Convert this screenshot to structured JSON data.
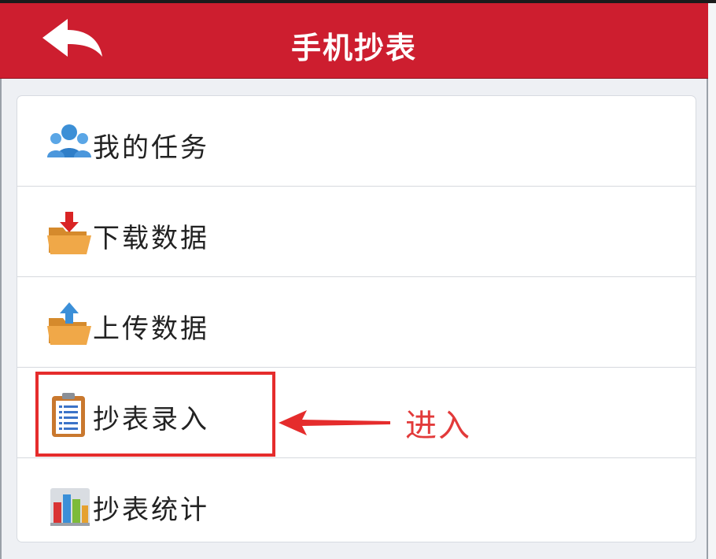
{
  "header": {
    "title": "手机抄表",
    "back_icon": "back-arrow-icon",
    "colors": {
      "bar": "#cd1e2f",
      "text": "#ffffff"
    }
  },
  "menu": {
    "items": [
      {
        "label": "我的任务",
        "icon": "users-icon"
      },
      {
        "label": "下载数据",
        "icon": "folder-download-icon"
      },
      {
        "label": "上传数据",
        "icon": "folder-upload-icon"
      },
      {
        "label": "抄表录入",
        "icon": "clipboard-list-icon"
      },
      {
        "label": "抄表统计",
        "icon": "bar-chart-icon"
      }
    ]
  },
  "annotation": {
    "text": "进入",
    "highlighted_item": "抄表录入",
    "color": "#e23a3a"
  }
}
